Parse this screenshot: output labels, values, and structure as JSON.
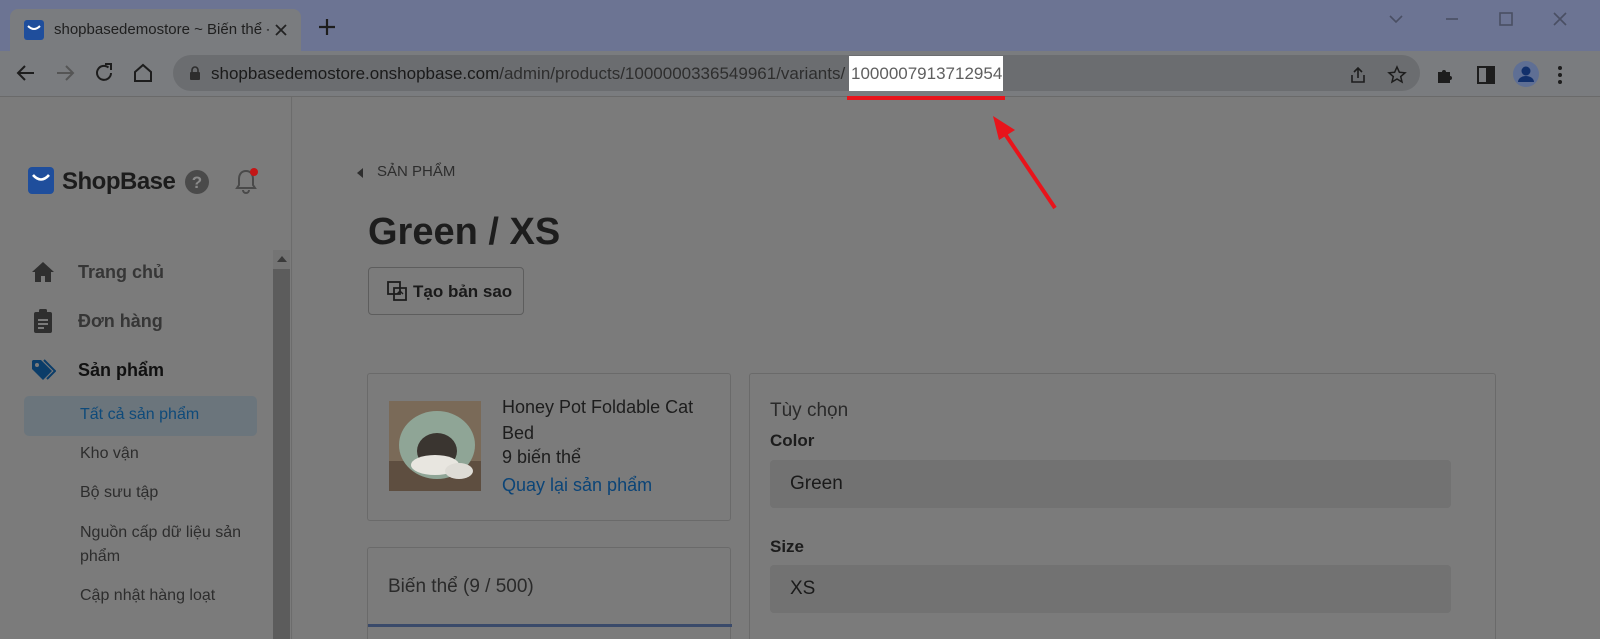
{
  "browser": {
    "tab_title": "shopbasedemostore ~ Biến thể - Sh",
    "url_host": "shopbasedemostore.onshopbase.com",
    "url_path": "/admin/products/1000000336549961/variants/",
    "url_highlight": "1000007913712954"
  },
  "sidebar": {
    "logo": "ShopBase",
    "nav": [
      {
        "label": "Trang chủ",
        "icon": "home-icon"
      },
      {
        "label": "Đơn hàng",
        "icon": "clipboard-icon"
      },
      {
        "label": "Sản phẩm",
        "icon": "tags-icon"
      }
    ],
    "sub_items": [
      {
        "label": "Tất cả sản phẩm"
      },
      {
        "label": "Kho vận"
      },
      {
        "label": "Bộ sưu tập"
      },
      {
        "label": "Nguồn cấp dữ liệu sản"
      },
      {
        "label": "phẩm"
      },
      {
        "label": "Cập nhật hàng loạt"
      }
    ]
  },
  "main": {
    "breadcrumb": "SẢN PHẨM",
    "title": "Green / XS",
    "duplicate_label": "Tạo bản sao",
    "product": {
      "name": "Honey Pot Foldable Cat Bed",
      "variant_count": "9 biến thể",
      "back_link": "Quay lại sản phẩm"
    },
    "variants_title": "Biến thể (9 / 500)",
    "options": {
      "title": "Tùy chọn",
      "fields": [
        {
          "label": "Color",
          "value": "Green"
        },
        {
          "label": "Size",
          "value": "XS"
        }
      ]
    }
  },
  "colors": {
    "annotation_red": "#e8141b",
    "link_blue": "#0b4477",
    "brand_blue": "#1f4e9c"
  }
}
